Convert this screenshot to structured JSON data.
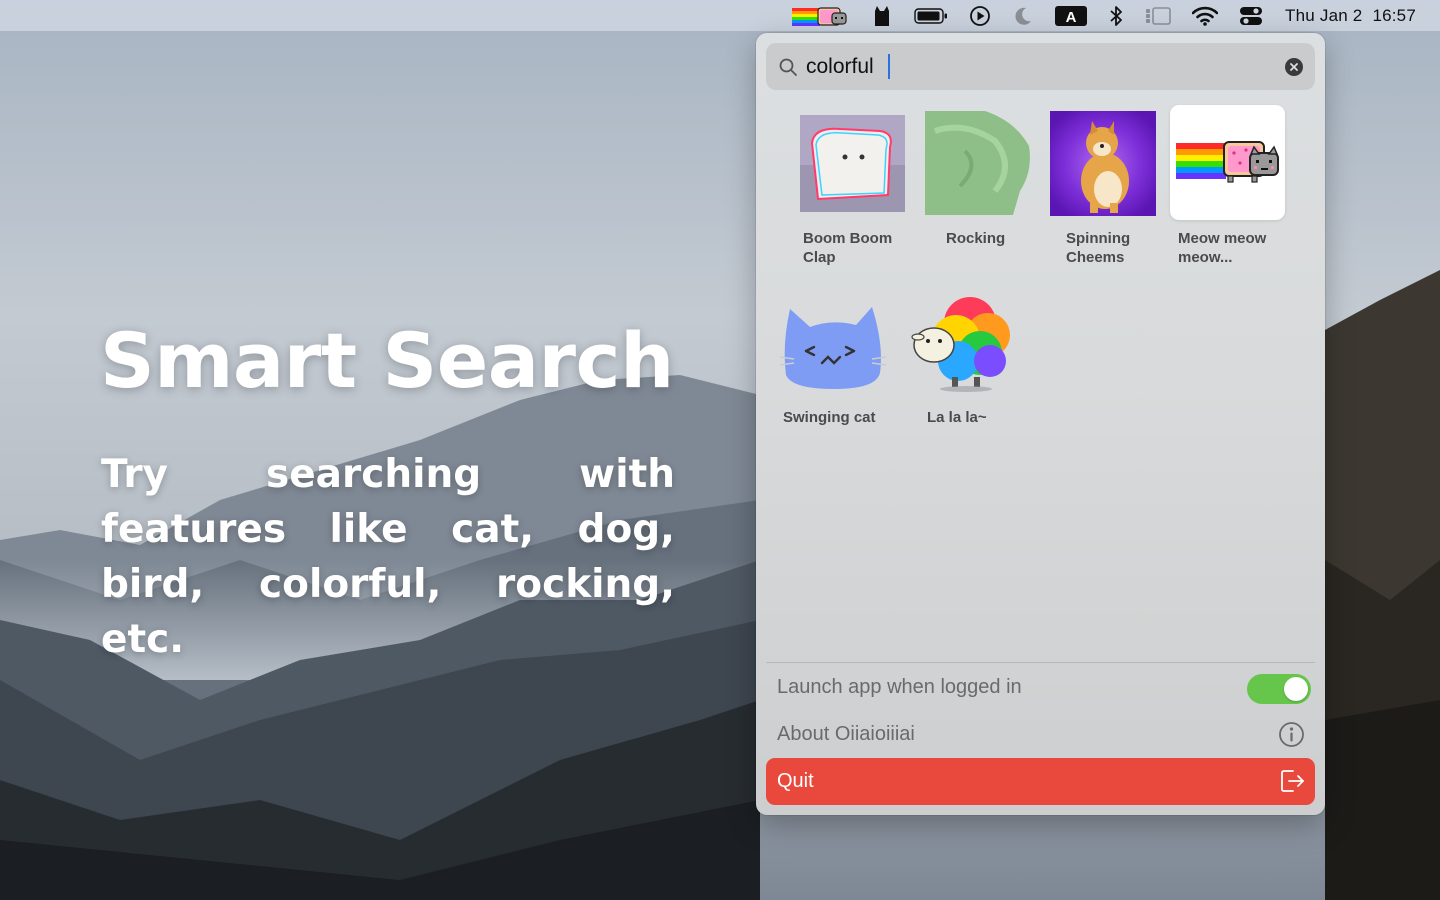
{
  "menubar": {
    "status_icons": [
      "nyan-cat-icon",
      "cat-silhouette-icon",
      "battery-icon",
      "play-circle-icon",
      "moon-icon",
      "input-source-icon",
      "bluetooth-icon",
      "stage-manager-icon",
      "wifi-icon",
      "control-center-icon"
    ],
    "input_source_letter": "A",
    "date": "Thu Jan 2",
    "time": "16:57"
  },
  "promo": {
    "title": "Smart Search",
    "description": "Try searching with features like cat, dog, bird, colorful, rocking, etc."
  },
  "panel": {
    "search": {
      "value": "colorful",
      "icon": "search-icon",
      "clear_icon": "clear-icon"
    },
    "results": [
      {
        "label_line1": "Boom Boom",
        "label_line2": "Clap",
        "icon": "boom-boom-clap-thumbnail"
      },
      {
        "label_line1": "Rocking",
        "label_line2": "",
        "icon": "rocking-thumbnail"
      },
      {
        "label_line1": "Spinning",
        "label_line2": "Cheems",
        "icon": "spinning-cheems-thumbnail"
      },
      {
        "label_line1": "Meow meow",
        "label_line2": "meow...",
        "icon": "nyan-cat-thumbnail",
        "selected": true
      },
      {
        "label_line1": "Swinging cat",
        "label_line2": "",
        "icon": "swinging-cat-thumbnail"
      },
      {
        "label_line1": "La la la~",
        "label_line2": "",
        "icon": "rainbow-sheep-thumbnail"
      }
    ],
    "launch_at_login": {
      "label": "Launch app when logged in",
      "enabled": true
    },
    "about": {
      "label": "About Oiiaioiiiai",
      "icon": "info-icon"
    },
    "quit": {
      "label": "Quit",
      "icon": "exit-icon"
    }
  },
  "colors": {
    "quit_red": "#e8493c",
    "toggle_green": "#66c64b",
    "caret_blue": "#2f6fe4"
  }
}
